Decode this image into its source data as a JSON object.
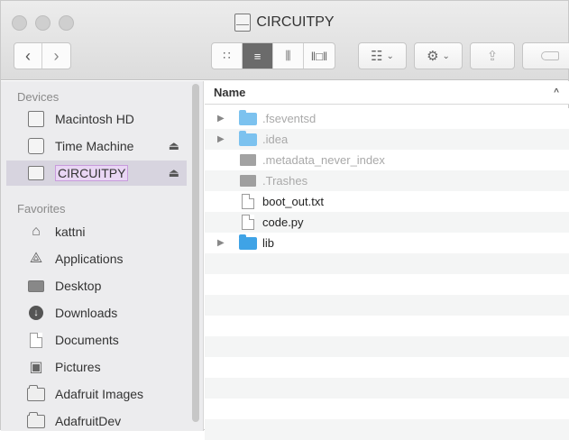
{
  "window": {
    "title": "CIRCUITPY"
  },
  "toolbar": {
    "back_icon": "chevron-left",
    "forward_icon": "chevron-right",
    "view_modes": [
      "icon-view",
      "list-view",
      "column-view",
      "cover-flow-view"
    ],
    "arrange_icon": "grid-arrange",
    "action_icon": "gear",
    "share_icon": "share",
    "tag_icon": "tag"
  },
  "sidebar": {
    "sections": [
      {
        "title": "Devices",
        "items": [
          {
            "label": "Macintosh HD",
            "icon": "hard-drive",
            "eject": false,
            "selected": false
          },
          {
            "label": "Time Machine",
            "icon": "time-machine",
            "eject": true,
            "selected": false
          },
          {
            "label": "CIRCUITPY",
            "icon": "external-drive",
            "eject": true,
            "selected": true
          }
        ]
      },
      {
        "title": "Favorites",
        "items": [
          {
            "label": "kattni",
            "icon": "home"
          },
          {
            "label": "Applications",
            "icon": "applications"
          },
          {
            "label": "Desktop",
            "icon": "desktop"
          },
          {
            "label": "Downloads",
            "icon": "downloads"
          },
          {
            "label": "Documents",
            "icon": "documents"
          },
          {
            "label": "Pictures",
            "icon": "pictures"
          },
          {
            "label": "Adafruit Images",
            "icon": "folder"
          },
          {
            "label": "AdafruitDev",
            "icon": "folder"
          }
        ]
      }
    ]
  },
  "list": {
    "column_header": "Name",
    "sort_indicator": "^",
    "files": [
      {
        "name": ".fseventsd",
        "type": "folder",
        "hidden": true,
        "expandable": true
      },
      {
        "name": ".idea",
        "type": "folder",
        "hidden": true,
        "expandable": true
      },
      {
        "name": ".metadata_never_index",
        "type": "file-dark",
        "hidden": true,
        "expandable": false
      },
      {
        "name": ".Trashes",
        "type": "file-dark",
        "hidden": true,
        "expandable": false
      },
      {
        "name": "boot_out.txt",
        "type": "document",
        "hidden": false,
        "expandable": false
      },
      {
        "name": "code.py",
        "type": "document",
        "hidden": false,
        "expandable": false
      },
      {
        "name": "lib",
        "type": "folder",
        "hidden": false,
        "expandable": true
      }
    ]
  }
}
